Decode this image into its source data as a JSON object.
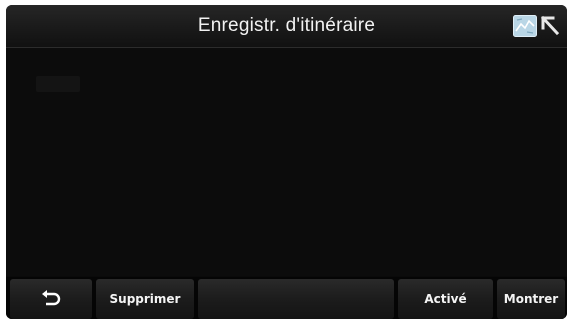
{
  "header": {
    "title": "Enregistr. d'itinéraire",
    "icons": [
      "map-icon",
      "arrow-icon"
    ]
  },
  "toolbar": {
    "back_icon": "back-arrow-icon",
    "delete_label": "Supprimer",
    "blank_label": "",
    "active_label": "Activé",
    "show_label": "Montrer"
  },
  "colors": {
    "background": "#0a0a0a",
    "text": "#f2f2f2",
    "button": "#1c1c1c",
    "map_icon": "#b9d6e6"
  }
}
